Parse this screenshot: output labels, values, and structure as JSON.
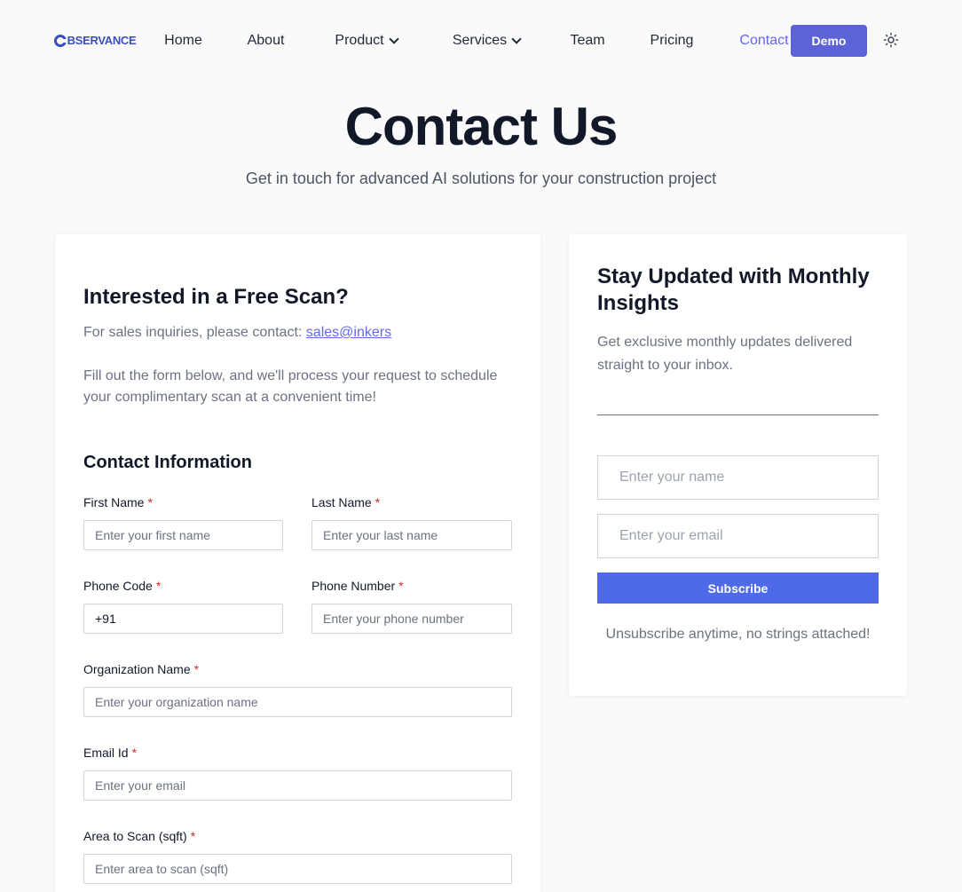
{
  "nav": {
    "logo_text": "BSERVANCE",
    "items": [
      "Home",
      "About",
      "Product",
      "Services",
      "Team",
      "Pricing",
      "Contact"
    ],
    "demo_label": "Demo",
    "theme_icon": "sun-icon"
  },
  "hero": {
    "title": "Contact Us",
    "subtitle": "Get in touch for advanced AI solutions for your construction project"
  },
  "form": {
    "heading": "Interested in a Free Scan?",
    "sales_prefix": "For sales inquiries, please contact:",
    "sales_email": "sales@inkers",
    "description": "Fill out the form below, and we'll process your request to schedule your complimentary scan at a convenient time!",
    "section_title": "Contact Information",
    "required_mark": "*",
    "fields": {
      "first_name": {
        "label": "First Name",
        "placeholder": "Enter your first name"
      },
      "last_name": {
        "label": "Last Name",
        "placeholder": "Enter your last name"
      },
      "phone_code": {
        "label": "Phone Code",
        "value": "+91"
      },
      "phone_number": {
        "label": "Phone Number",
        "placeholder": "Enter your phone number"
      },
      "organization": {
        "label": "Organization Name",
        "placeholder": "Enter your organization name"
      },
      "email": {
        "label": "Email Id",
        "placeholder": "Enter your email"
      },
      "area": {
        "label": "Area to Scan (sqft)",
        "placeholder": "Enter area to scan (sqft)"
      }
    }
  },
  "newsletter": {
    "heading": "Stay Updated with Monthly Insights",
    "description": "Get exclusive monthly updates delivered straight to your inbox.",
    "name_placeholder": "Enter your name",
    "email_placeholder": "Enter your email",
    "subscribe_label": "Subscribe",
    "footnote": "Unsubscribe anytime, no strings attached!"
  },
  "colors": {
    "accent": "#6366f1",
    "demo_button": "#5b63d6",
    "subscribe_button": "#4f6ae8",
    "required": "#dc2626"
  }
}
